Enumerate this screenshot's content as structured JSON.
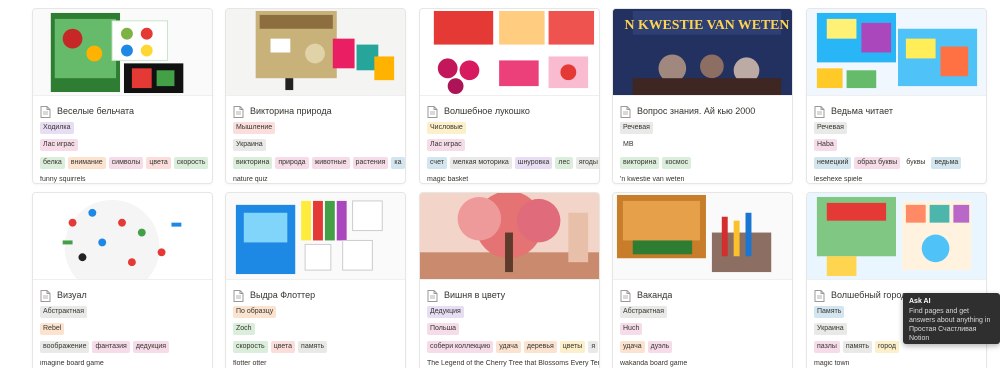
{
  "cards": [
    {
      "title": "Веселые бельчата",
      "image": "funny-squirrels-cover",
      "type": {
        "label": "Ходилка",
        "color": "purple"
      },
      "publisher": {
        "label": "Лас играс",
        "color": "pink"
      },
      "tags": [
        {
          "label": "белка",
          "color": "green"
        },
        {
          "label": "внимание",
          "color": "orange"
        },
        {
          "label": "символы",
          "color": "pink"
        },
        {
          "label": "цвета",
          "color": "red"
        },
        {
          "label": "скорость",
          "color": "green"
        }
      ],
      "english": "funny squirrels"
    },
    {
      "title": "Викторина природа",
      "image": "nature-quiz-cover",
      "type": {
        "label": "Мышление",
        "color": "red"
      },
      "publisher": {
        "label": "Украина",
        "color": "gray"
      },
      "tags": [
        {
          "label": "викторина",
          "color": "green"
        },
        {
          "label": "природа",
          "color": "pink"
        },
        {
          "label": "животные",
          "color": "pink"
        },
        {
          "label": "растения",
          "color": "pink"
        },
        {
          "label": "ка",
          "color": "blue"
        }
      ],
      "english": "nature quiz"
    },
    {
      "title": "Волшебное лукошко",
      "image": "magic-basket-cover",
      "type": {
        "label": "Числовые",
        "color": "yellow"
      },
      "publisher": {
        "label": "Лас играс",
        "color": "pink"
      },
      "tags": [
        {
          "label": "счет",
          "color": "blue"
        },
        {
          "label": "мелкая моторика",
          "color": "gray"
        },
        {
          "label": "шнуровка",
          "color": "purple"
        },
        {
          "label": "лес",
          "color": "green"
        },
        {
          "label": "ягоды",
          "color": "gray"
        }
      ],
      "english": "magic basket"
    },
    {
      "title": "Вопрос знания. Ай кью 2000",
      "image": "kwestie-van-weten-cover",
      "type": {
        "label": "Речевая",
        "color": "gray"
      },
      "publisher": {
        "label": "MB",
        "color": "none"
      },
      "tags": [
        {
          "label": "викторина",
          "color": "green"
        },
        {
          "label": "космос",
          "color": "green"
        }
      ],
      "english": "'n kwestie van weten"
    },
    {
      "title": "Ведьма читает",
      "image": "witch-reads-cover",
      "type": {
        "label": "Речевая",
        "color": "gray"
      },
      "publisher": {
        "label": "Haba",
        "color": "pink"
      },
      "tags": [
        {
          "label": "немецкий",
          "color": "blue"
        },
        {
          "label": "образ буквы",
          "color": "pink"
        },
        {
          "label": "буквы",
          "color": "none"
        },
        {
          "label": "ведьма",
          "color": "blue"
        }
      ],
      "english": "lesehexe spiele"
    },
    {
      "title": "Визуал",
      "image": "visual-cover",
      "type": {
        "label": "Абстрактная",
        "color": "gray"
      },
      "publisher": {
        "label": "Rebel",
        "color": "orange"
      },
      "tags": [
        {
          "label": "воображение",
          "color": "gray"
        },
        {
          "label": "фантазия",
          "color": "pink"
        },
        {
          "label": "дедукция",
          "color": "pink"
        }
      ],
      "english": "imagine board game"
    },
    {
      "title": "Выдра Флоттер",
      "image": "flotter-otter-cover",
      "type": {
        "label": "По образцу",
        "color": "orange"
      },
      "publisher": {
        "label": "Zoch",
        "color": "green"
      },
      "tags": [
        {
          "label": "скорость",
          "color": "green"
        },
        {
          "label": "цвета",
          "color": "red"
        },
        {
          "label": "память",
          "color": "gray"
        }
      ],
      "english": "flotter otter"
    },
    {
      "title": "Вишня в цвету",
      "image": "cherry-blossom-cover",
      "type": {
        "label": "Дедукция",
        "color": "purple"
      },
      "publisher": {
        "label": "Польша",
        "color": "pink"
      },
      "tags": [
        {
          "label": "собери коллекцию",
          "color": "pink"
        },
        {
          "label": "удача",
          "color": "orange"
        },
        {
          "label": "деревья",
          "color": "orange"
        },
        {
          "label": "цветы",
          "color": "yellow"
        },
        {
          "label": "я",
          "color": "gray"
        }
      ],
      "english": "The Legend of the Cherry Tree that Blossoms Every Ten"
    },
    {
      "title": "Ваканда",
      "image": "wakanda-cover",
      "type": {
        "label": "Абстрактная",
        "color": "gray"
      },
      "publisher": {
        "label": "Huch",
        "color": "pink"
      },
      "tags": [
        {
          "label": "удача",
          "color": "orange"
        },
        {
          "label": "дуэль",
          "color": "pink"
        }
      ],
      "english": "wakanda board game"
    },
    {
      "title": "Волшебный городок",
      "image": "magic-town-cover",
      "type": {
        "label": "Память",
        "color": "blue"
      },
      "publisher": {
        "label": "Украина",
        "color": "gray"
      },
      "tags": [
        {
          "label": "пазлы",
          "color": "pink"
        },
        {
          "label": "память",
          "color": "gray"
        },
        {
          "label": "город",
          "color": "yellow"
        }
      ],
      "english": "magic town"
    }
  ],
  "tooltip": {
    "title": "Ask AI",
    "body": "Find pages and get answers about anything in Простая Счастливая Notion"
  }
}
